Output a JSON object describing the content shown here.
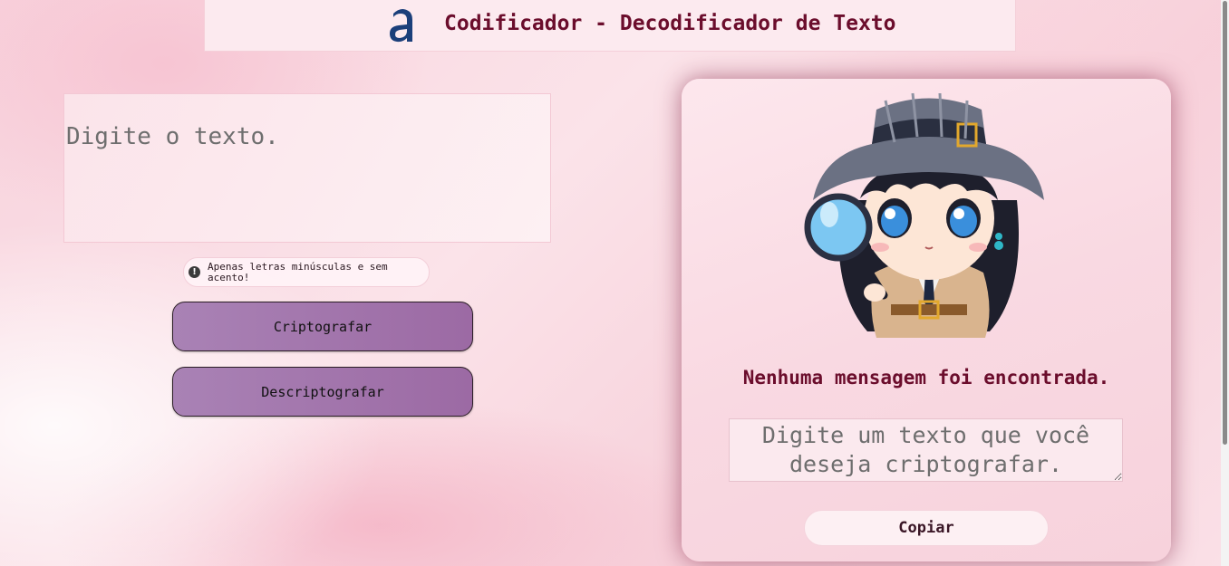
{
  "header": {
    "logo_icon": "alura-a-logo-icon",
    "title": "Codificador - Decodificador de Texto"
  },
  "input": {
    "placeholder": "Digite o texto.",
    "value": ""
  },
  "notice": {
    "icon": "exclamation-circle-icon",
    "text": "Apenas letras minúsculas e sem acento!"
  },
  "buttons": {
    "encrypt": "Criptografar",
    "decrypt": "Descriptografar",
    "copy": "Copiar"
  },
  "output": {
    "illustration": "detective-girl-with-magnifying-glass",
    "empty_message": "Nenhuma mensagem foi encontrada.",
    "placeholder": "Digite um texto que você deseja criptografar.",
    "value": ""
  },
  "colors": {
    "accent": "#6b0d2c",
    "button_purple": "#a478af",
    "background": "#f8d3dd"
  }
}
